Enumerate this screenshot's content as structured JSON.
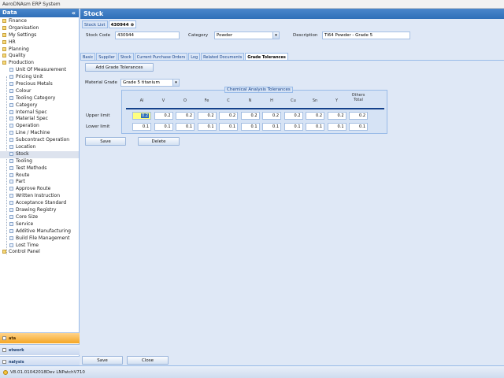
{
  "window": {
    "title": "AeroDNAsm ERP System"
  },
  "sidebar": {
    "header": "Data",
    "collapse_glyph": "«",
    "items": [
      {
        "label": "Finance",
        "level": 0
      },
      {
        "label": "Organisation",
        "level": 0
      },
      {
        "label": "My Settings",
        "level": 0
      },
      {
        "label": "HR",
        "level": 0
      },
      {
        "label": "Planning",
        "level": 0
      },
      {
        "label": "Quality",
        "level": 0
      },
      {
        "label": "Production",
        "level": 0
      },
      {
        "label": "Unit Of Measurement",
        "level": 1
      },
      {
        "label": "Pricing Unit",
        "level": 1
      },
      {
        "label": "Precious Metals",
        "level": 1
      },
      {
        "label": "Colour",
        "level": 1
      },
      {
        "label": "Tooling Category",
        "level": 1
      },
      {
        "label": "Category",
        "level": 1
      },
      {
        "label": "Internal Spec",
        "level": 1
      },
      {
        "label": "Material Spec",
        "level": 1
      },
      {
        "label": "Operation",
        "level": 1
      },
      {
        "label": "Line / Machine",
        "level": 1
      },
      {
        "label": "Subcontract Operation",
        "level": 1
      },
      {
        "label": "Location",
        "level": 1
      },
      {
        "label": "Stock",
        "level": 1,
        "selected": true
      },
      {
        "label": "Tooling",
        "level": 1
      },
      {
        "label": "Test Methods",
        "level": 1
      },
      {
        "label": "Route",
        "level": 1
      },
      {
        "label": "Part",
        "level": 1
      },
      {
        "label": "Approve Route",
        "level": 1
      },
      {
        "label": "Written Instruction",
        "level": 1
      },
      {
        "label": "Acceptance Standard",
        "level": 1
      },
      {
        "label": "Drawing Registry",
        "level": 1
      },
      {
        "label": "Core Size",
        "level": 1
      },
      {
        "label": "Service",
        "level": 1
      },
      {
        "label": "Additive Manufacturing",
        "level": 1
      },
      {
        "label": "Build File Management",
        "level": 1
      },
      {
        "label": "Lost Time",
        "level": 1
      },
      {
        "label": "Control Panel",
        "level": 0
      }
    ],
    "modules": [
      {
        "label": "ata",
        "active": true
      },
      {
        "label": "etwork",
        "active": false
      },
      {
        "label": "nalysis",
        "active": false
      }
    ]
  },
  "main": {
    "header": "Stock",
    "doc_tabs": [
      {
        "label": "Stock List",
        "active": false
      },
      {
        "label": "430944",
        "active": true,
        "close": "⊗"
      }
    ],
    "form": {
      "stock_code_label": "Stock Code",
      "stock_code_value": "430944",
      "category_label": "Category",
      "category_value": "Powder",
      "description_label": "Description",
      "description_value": "Ti64 Powder - Grade 5"
    },
    "sub_tabs": [
      {
        "label": "Basic",
        "active": false
      },
      {
        "label": "Supplier",
        "active": false
      },
      {
        "label": "Stock",
        "active": false
      },
      {
        "label": "Current Purchase Orders",
        "active": false
      },
      {
        "label": "Log",
        "active": false
      },
      {
        "label": "Related Documents",
        "active": false
      },
      {
        "label": "Grade Tolerances",
        "active": true
      }
    ],
    "add_button": "Add Grade Tolerances",
    "material_grade_label": "Material Grade",
    "material_grade_value": "Grade 5 titanium",
    "tolerances": {
      "title": "Chemical Analysis Tolerances",
      "columns": [
        "Al",
        "V",
        "O",
        "Fe",
        "C",
        "N",
        "H",
        "Cu",
        "Sn",
        "Y",
        "Others Total"
      ],
      "rows": [
        {
          "label": "Upper limit",
          "values": [
            "0.2",
            "0.2",
            "0.2",
            "0.2",
            "0.2",
            "0.2",
            "0.2",
            "0.2",
            "0.2",
            "0.2",
            "0.2"
          ]
        },
        {
          "label": "Lower limit",
          "values": [
            "0.1",
            "0.1",
            "0.1",
            "0.1",
            "0.1",
            "0.1",
            "0.1",
            "0.1",
            "0.1",
            "0.1",
            "0.1"
          ]
        }
      ]
    },
    "save_label": "Save",
    "delete_label": "Delete",
    "footer_save_label": "Save",
    "footer_close_label": "Close"
  },
  "status": {
    "version": "V8.01.01042018Dev LNPatchV710"
  }
}
